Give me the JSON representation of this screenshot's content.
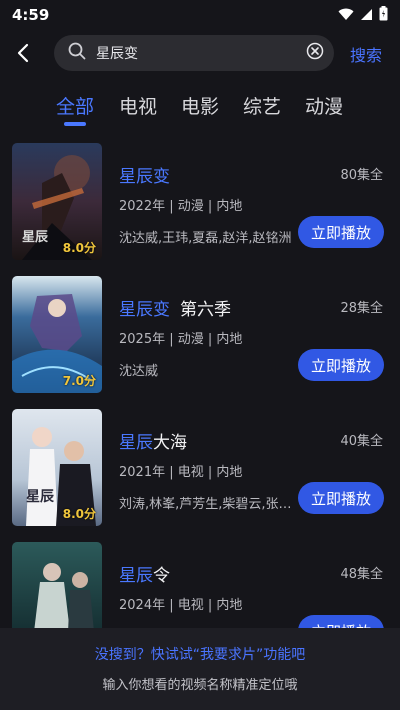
{
  "status": {
    "time": "4:59"
  },
  "search": {
    "query": "星辰变",
    "button": "搜索"
  },
  "tabs": [
    {
      "label": "全部",
      "active": true
    },
    {
      "label": "电视",
      "active": false
    },
    {
      "label": "电影",
      "active": false
    },
    {
      "label": "综艺",
      "active": false
    },
    {
      "label": "动漫",
      "active": false
    }
  ],
  "results": [
    {
      "title_highlight": "星辰变",
      "title_rest": "",
      "episodes": "80集全",
      "meta": "2022年 | 动漫 | 内地",
      "cast": "沈达威,王玮,夏磊,赵洋,赵铭洲",
      "score": "8.0分",
      "play": "立即播放"
    },
    {
      "title_highlight": "星辰变",
      "title_rest": "第六季",
      "episodes": "28集全",
      "meta": "2025年 | 动漫 | 内地",
      "cast": "沈达威",
      "score": "7.0分",
      "play": "立即播放"
    },
    {
      "title_highlight": "星辰",
      "title_rest": "大海",
      "episodes": "40集全",
      "meta": "2021年 | 电视 | 内地",
      "cast": "刘涛,林峯,芦芳生,柴碧云,张晞临",
      "score": "8.0分",
      "play": "立即播放"
    },
    {
      "title_highlight": "星辰",
      "title_rest": "令",
      "episodes": "48集全",
      "meta": "2024年 | 电视 | 内地",
      "cast": "",
      "score": "",
      "play": "立即播放"
    }
  ],
  "bottom": {
    "hint_primary": "没搜到？快试试“我要求片”功能吧",
    "hint_secondary": "输入你想看的视频名称精准定位哦"
  },
  "colors": {
    "accent": "#4a78ff",
    "button": "#3158e4",
    "background": "#15151a",
    "score": "#f0c63c"
  }
}
